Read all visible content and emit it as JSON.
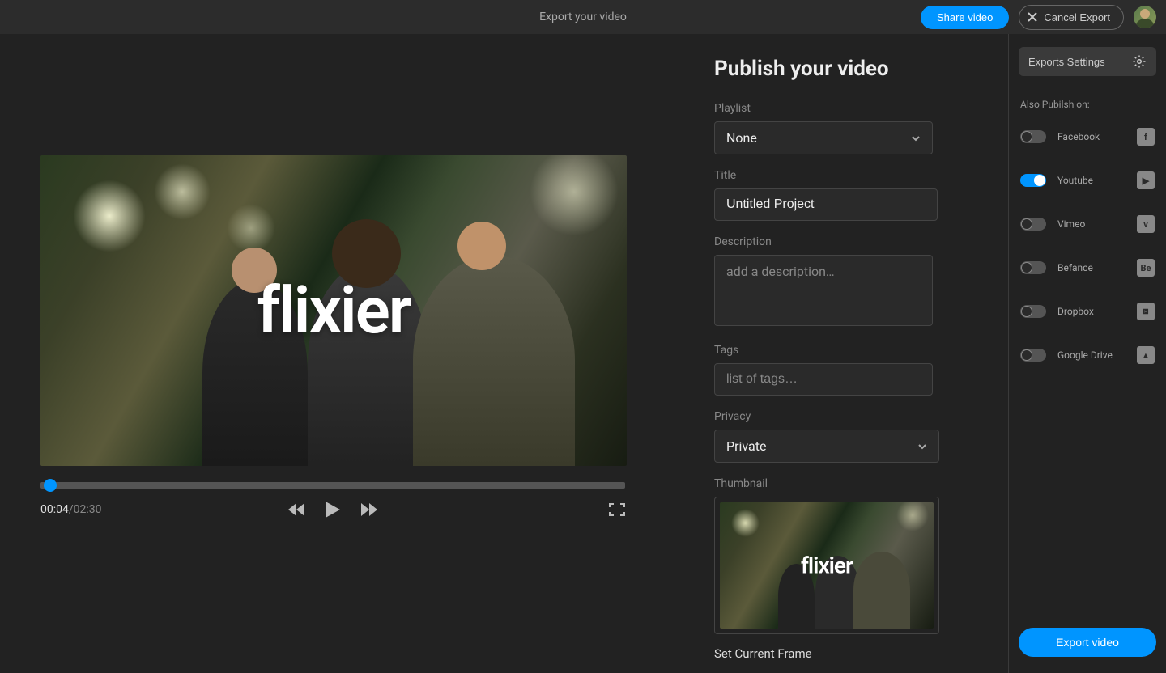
{
  "topbar": {
    "title": "Export your video",
    "share_label": "Share video",
    "cancel_label": "Cancel Export"
  },
  "preview": {
    "logo_text": "flixier",
    "current_time": "00:04",
    "total_time": "02:30",
    "time_separator": " / "
  },
  "publish": {
    "heading": "Publish your video",
    "playlist_label": "Playlist",
    "playlist_value": "None",
    "title_label": "Title",
    "title_value": "Untitled Project",
    "description_label": "Description",
    "description_placeholder": "add a description…",
    "tags_label": "Tags",
    "tags_placeholder": "list of tags…",
    "privacy_label": "Privacy",
    "privacy_value": "Private",
    "thumbnail_label": "Thumbnail",
    "set_frame_label": "Set Current Frame"
  },
  "side": {
    "exports_settings_label": "Exports Settings",
    "also_publish_label": "Also Pubilsh on:",
    "targets": [
      {
        "name": "Facebook",
        "on": false,
        "icon": "f"
      },
      {
        "name": "Youtube",
        "on": true,
        "icon": "▶"
      },
      {
        "name": "Vimeo",
        "on": false,
        "icon": "v"
      },
      {
        "name": "Befance",
        "on": false,
        "icon": "Bē"
      },
      {
        "name": "Dropbox",
        "on": false,
        "icon": "⧈"
      },
      {
        "name": "Google Drive",
        "on": false,
        "icon": "▲"
      }
    ],
    "export_label": "Export video"
  }
}
